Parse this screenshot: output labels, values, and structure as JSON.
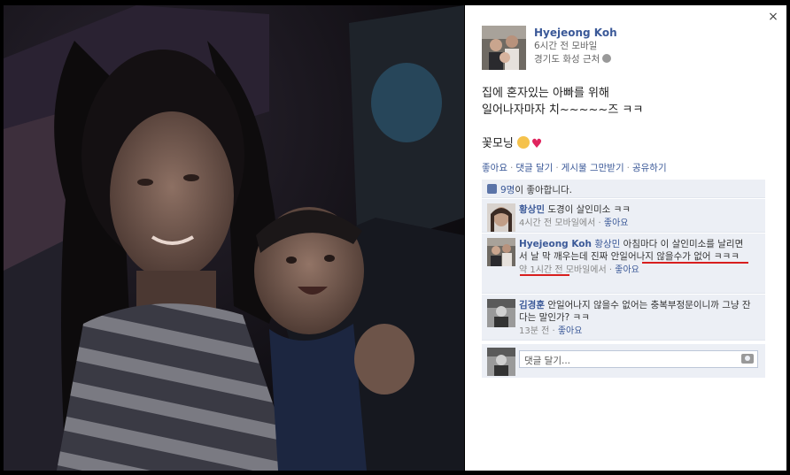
{
  "post": {
    "author_name": "Hyejeong Koh",
    "time": "6시간 전 모바일",
    "location": "경기도 화성 근처",
    "text_line1": "집에 혼자있는 아빠를 위해",
    "text_line2": "일어나자마자 치~~~~~즈 ㅋㅋ",
    "text_line3": "꽃모닝"
  },
  "actions": {
    "like": "좋아요",
    "comment": "댓글 달기",
    "follow": "게시물 그만받기",
    "share": "공유하기",
    "separator": "·"
  },
  "likes": {
    "count": "9명",
    "suffix": "이 좋아합니다."
  },
  "comments": [
    {
      "author": "황상민",
      "text": "도경이 살인미소 ㅋㅋ",
      "meta": "4시간 전 모바일에서 ·",
      "like_label": "좋아요"
    },
    {
      "author": "Hyejeong Koh",
      "mention": "황상민",
      "text": "아침마다 이 살인미소를 날리면서 날 막 깨우는데 진짜 안일어나지 않을수가 없어 ㅋㅋㅋ",
      "meta": "약 1시간 전 모바일에서 ·",
      "like_label": "좋아요"
    },
    {
      "author": "김경훈",
      "text": "안일어나지 않을수 없어는 충복부정문이니까 그냥 잔다는 말인가? ㅋㅋ",
      "meta": "13분 전 ·",
      "like_label": "좋아요"
    }
  ],
  "comment_input": {
    "placeholder": "댓글 달기..."
  },
  "close_label": "×",
  "colors": {
    "link": "#3b5998",
    "highlight": "#d81e1e",
    "panel_bg": "#ffffff",
    "comment_bg": "#eceff5"
  }
}
